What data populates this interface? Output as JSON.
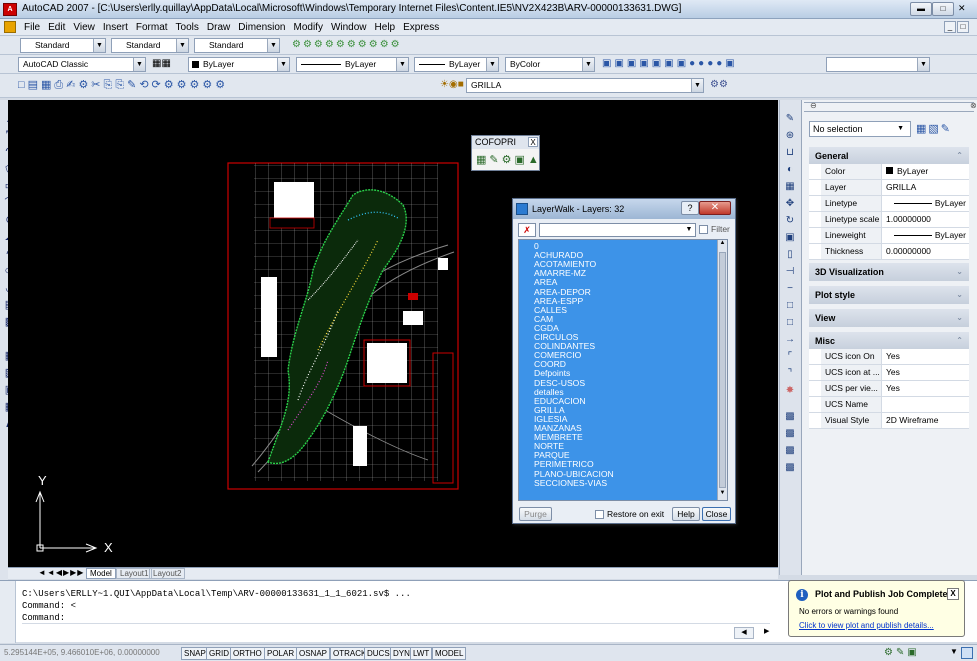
{
  "window": {
    "title": "AutoCAD 2007 - [C:\\Users\\erlly.quillay\\AppData\\Local\\Microsoft\\Windows\\Temporary Internet Files\\Content.IE5\\NV2X423B\\ARV-00000133631.DWG]",
    "app_icon": "A"
  },
  "menu": [
    "File",
    "Edit",
    "View",
    "Insert",
    "Format",
    "Tools",
    "Draw",
    "Dimension",
    "Modify",
    "Window",
    "Help",
    "Express"
  ],
  "toolbar1": {
    "text_style": "Standard",
    "dim_style": "Standard",
    "table_style": "Standard"
  },
  "toolbar2": {
    "workspace": "AutoCAD Classic",
    "layer_color": "ByLayer",
    "linetype": "ByLayer",
    "lineweight": "ByLayer",
    "plot_style": "ByColor"
  },
  "toolbar3": {
    "current_layer": "GRILLA"
  },
  "layout_tabs": [
    "Model",
    "Layout1",
    "Layout2"
  ],
  "ucs": {
    "y": "Y",
    "x": "X"
  },
  "cofopri": {
    "title": "COFOPRI",
    "close": "X"
  },
  "layerwalk": {
    "title": "LayerWalk - Layers: 32",
    "filter_label": "Filter",
    "layers": [
      "0",
      "ACHURADO",
      "ACOTAMIENTO",
      "AMARRE-MZ",
      "AREA",
      "AREA-DEPOR",
      "AREA-ESPP",
      "CALLES",
      "CAM",
      "CGDA",
      "CIRCULOS",
      "COLINDANTES",
      "COMERCIO",
      "COORD",
      "Defpoints",
      "DESC-USOS",
      "detalles",
      "EDUCACION",
      "GRILLA",
      "IGLESIA",
      "MANZANAS",
      "MEMBRETE",
      "NORTE",
      "PARQUE",
      "PERIMETRICO",
      "PLANO-UBICACION",
      "SECCIONES-VIAS"
    ],
    "purge": "Purge",
    "restore_on_exit": "Restore on exit",
    "help": "Help",
    "close": "Close"
  },
  "properties": {
    "selection": "No selection",
    "general": {
      "title": "General",
      "rows": [
        {
          "key": "Color",
          "value": "ByLayer"
        },
        {
          "key": "Layer",
          "value": "GRILLA"
        },
        {
          "key": "Linetype",
          "value": "ByLayer"
        },
        {
          "key": "Linetype scale",
          "value": "1.00000000"
        },
        {
          "key": "Lineweight",
          "value": "ByLayer"
        },
        {
          "key": "Thickness",
          "value": "0.00000000"
        }
      ]
    },
    "visualization": "3D Visualization",
    "plot_style": "Plot style",
    "view": "View",
    "misc": {
      "title": "Misc",
      "rows": [
        {
          "key": "UCS icon On",
          "value": "Yes"
        },
        {
          "key": "UCS icon at ...",
          "value": "Yes"
        },
        {
          "key": "UCS per vie...",
          "value": "Yes"
        },
        {
          "key": "UCS Name",
          "value": ""
        },
        {
          "key": "Visual Style",
          "value": "2D Wireframe"
        }
      ]
    }
  },
  "command": {
    "line1": "C:\\Users\\ERLLY~1.QUI\\AppData\\Local\\Temp\\ARV-00000133631_1_1_6021.sv$ ...",
    "line2": "Command: <",
    "line3": "Command:"
  },
  "notification": {
    "title": "Plot and Publish Job Complete",
    "message": "No errors or warnings found",
    "link": "Click to view plot and publish details...",
    "close": "X"
  },
  "status": {
    "coords": "5.295144E+05, 9.466010E+06, 0.00000000",
    "buttons": [
      "SNAP",
      "GRID",
      "ORTHO",
      "POLAR",
      "OSNAP",
      "OTRACK",
      "DUCS",
      "DYN",
      "LWT",
      "MODEL"
    ]
  },
  "colors": {
    "drawing_bg": "#000000",
    "border_red": "#cc0000",
    "list_blue": "#3d93e8",
    "grid_gray": "#9a9a9a"
  }
}
